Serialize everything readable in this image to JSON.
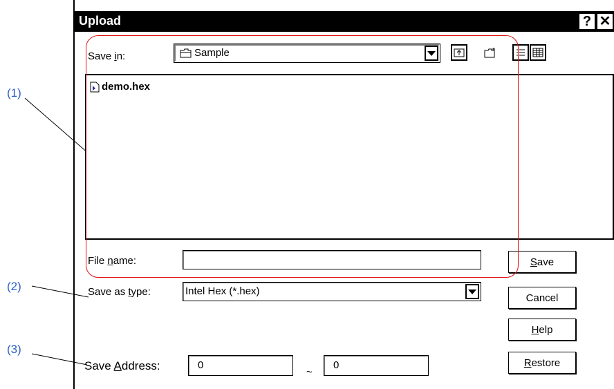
{
  "dialog": {
    "title": "Upload",
    "help_glyph": "?",
    "close_glyph": "✕"
  },
  "callouts": [
    "(1)",
    "(2)",
    "(3)"
  ],
  "save_in": {
    "label_pre": "Save ",
    "label_ul": "i",
    "label_post": "n:",
    "value": "Sample"
  },
  "files": [
    {
      "name": "demo.hex"
    }
  ],
  "file_name": {
    "label_pre": "File ",
    "label_ul": "n",
    "label_post": "ame:",
    "value": ""
  },
  "save_as_type": {
    "label_pre": "Save as ",
    "label_ul": "t",
    "label_post": "ype:",
    "value": "Intel Hex (*.hex)"
  },
  "save_address": {
    "label_pre": "Save ",
    "label_ul": "A",
    "label_post": "ddress:",
    "start": "0",
    "separator": "~",
    "end": "0"
  },
  "buttons": {
    "save_ul": "S",
    "save_rest": "ave",
    "cancel": "Cancel",
    "help_ul": "H",
    "help_rest": "elp",
    "restore_ul": "R",
    "restore_rest": "estore"
  },
  "colors": {
    "callout": "#2a5fc8",
    "highlight": "#e01010"
  }
}
